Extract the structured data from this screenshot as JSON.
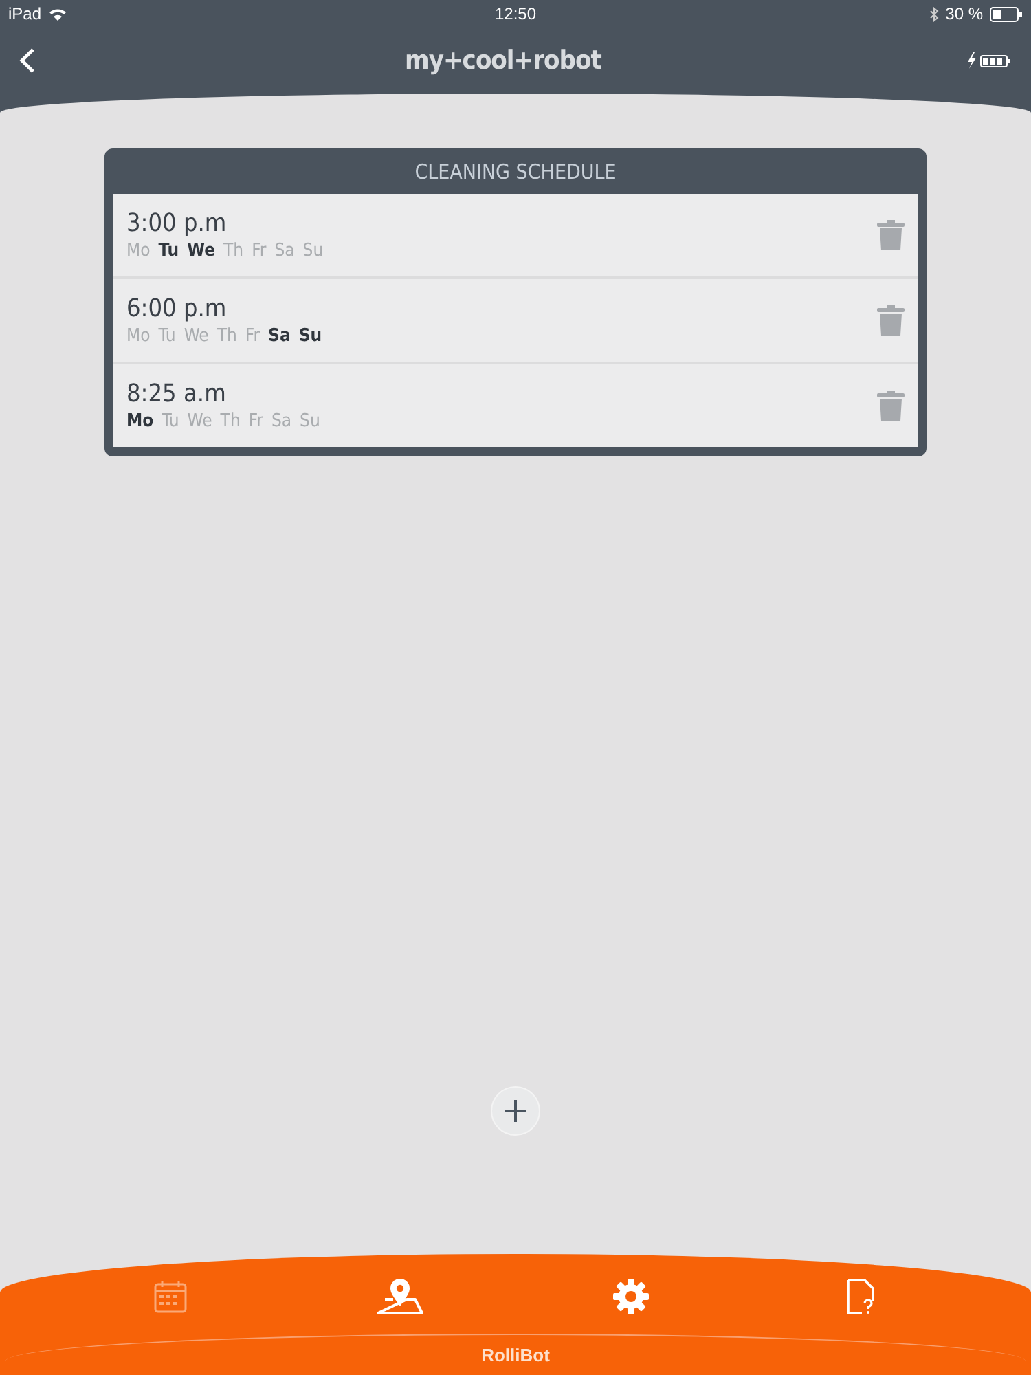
{
  "status_bar": {
    "device": "iPad",
    "time": "12:50",
    "battery": "30 %"
  },
  "nav": {
    "title": "my+cool+robot"
  },
  "schedule": {
    "title": "CLEANING SCHEDULE",
    "entries": [
      {
        "time": "3:00 p.m",
        "days": [
          {
            "label": "Mo",
            "on": false
          },
          {
            "label": "Tu",
            "on": true
          },
          {
            "label": "We",
            "on": true
          },
          {
            "label": "Th",
            "on": false
          },
          {
            "label": "Fr",
            "on": false
          },
          {
            "label": "Sa",
            "on": false
          },
          {
            "label": "Su",
            "on": false
          }
        ]
      },
      {
        "time": "6:00 p.m",
        "days": [
          {
            "label": "Mo",
            "on": false
          },
          {
            "label": "Tu",
            "on": false
          },
          {
            "label": "We",
            "on": false
          },
          {
            "label": "Th",
            "on": false
          },
          {
            "label": "Fr",
            "on": false
          },
          {
            "label": "Sa",
            "on": true
          },
          {
            "label": "Su",
            "on": true
          }
        ]
      },
      {
        "time": "8:25 a.m",
        "days": [
          {
            "label": "Mo",
            "on": true
          },
          {
            "label": "Tu",
            "on": false
          },
          {
            "label": "We",
            "on": false
          },
          {
            "label": "Th",
            "on": false
          },
          {
            "label": "Fr",
            "on": false
          },
          {
            "label": "Sa",
            "on": false
          },
          {
            "label": "Su",
            "on": false
          }
        ]
      }
    ]
  },
  "tabs": [
    {
      "kind": "calendar",
      "selected": true
    },
    {
      "kind": "map",
      "selected": false
    },
    {
      "kind": "settings",
      "selected": false
    },
    {
      "kind": "help",
      "selected": false
    }
  ],
  "footer": {
    "label": "RolliBot"
  }
}
